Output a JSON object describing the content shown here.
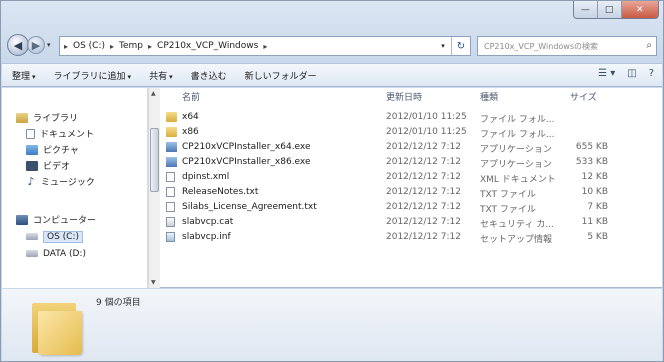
{
  "window": {
    "controls": {
      "minimize": "—",
      "maximize": "□",
      "close": "✕"
    }
  },
  "nav": {
    "back": "◀",
    "forward": "▶",
    "dropdown": "▾"
  },
  "address": {
    "crumbs": [
      "OS (C:)",
      "Temp",
      "CP210x_VCP_Windows"
    ],
    "separator": "▸",
    "dropdown": "▾",
    "refresh": "↻"
  },
  "search": {
    "placeholder": "CP210x_VCP_Windowsの検索",
    "icon": "⌕"
  },
  "toolbar": {
    "items": [
      "整理",
      "ライブラリに追加",
      "共有",
      "書き込む",
      "新しいフォルダー"
    ],
    "has_dropdown": [
      true,
      true,
      true,
      false,
      false
    ],
    "view": "☰ ▾",
    "preview": "◫",
    "help": "?"
  },
  "navpane": {
    "items": [
      {
        "label": "ライブラリ",
        "icon": "library-icon"
      },
      {
        "label": "ドキュメント",
        "icon": "documents-icon"
      },
      {
        "label": "ピクチャ",
        "icon": "pictures-icon"
      },
      {
        "label": "ビデオ",
        "icon": "videos-icon"
      },
      {
        "label": "ミュージック",
        "icon": "music-icon"
      },
      {
        "label": "コンピューター",
        "icon": "computer-icon"
      },
      {
        "label": "OS (C:)",
        "icon": "drive-icon",
        "selected": true
      },
      {
        "label": "DATA (D:)",
        "icon": "drive-icon"
      }
    ]
  },
  "columns": {
    "name": "名前",
    "date": "更新日時",
    "type": "種類",
    "size": "サイズ"
  },
  "files": [
    {
      "name": "x64",
      "date": "2012/01/10 11:25",
      "type": "ファイル フォル...",
      "size": "",
      "icon": "folder"
    },
    {
      "name": "x86",
      "date": "2012/01/10 11:25",
      "type": "ファイル フォル...",
      "size": "",
      "icon": "folder"
    },
    {
      "name": "CP210xVCPInstaller_x64.exe",
      "date": "2012/12/12 7:12",
      "type": "アプリケーション",
      "size": "655 KB",
      "icon": "exe"
    },
    {
      "name": "CP210xVCPInstaller_x86.exe",
      "date": "2012/12/12 7:12",
      "type": "アプリケーション",
      "size": "533 KB",
      "icon": "exe"
    },
    {
      "name": "dpinst.xml",
      "date": "2012/12/12 7:12",
      "type": "XML ドキュメント",
      "size": "12 KB",
      "icon": "doc"
    },
    {
      "name": "ReleaseNotes.txt",
      "date": "2012/12/12 7:12",
      "type": "TXT ファイル",
      "size": "10 KB",
      "icon": "doc"
    },
    {
      "name": "Silabs_License_Agreement.txt",
      "date": "2012/12/12 7:12",
      "type": "TXT ファイル",
      "size": "7 KB",
      "icon": "doc"
    },
    {
      "name": "slabvcp.cat",
      "date": "2012/12/12 7:12",
      "type": "セキュリティ カ...",
      "size": "11 KB",
      "icon": "cat"
    },
    {
      "name": "slabvcp.inf",
      "date": "2012/12/12 7:12",
      "type": "セットアップ情報",
      "size": "5 KB",
      "icon": "inf"
    }
  ],
  "details": {
    "count": "9 個の項目"
  }
}
